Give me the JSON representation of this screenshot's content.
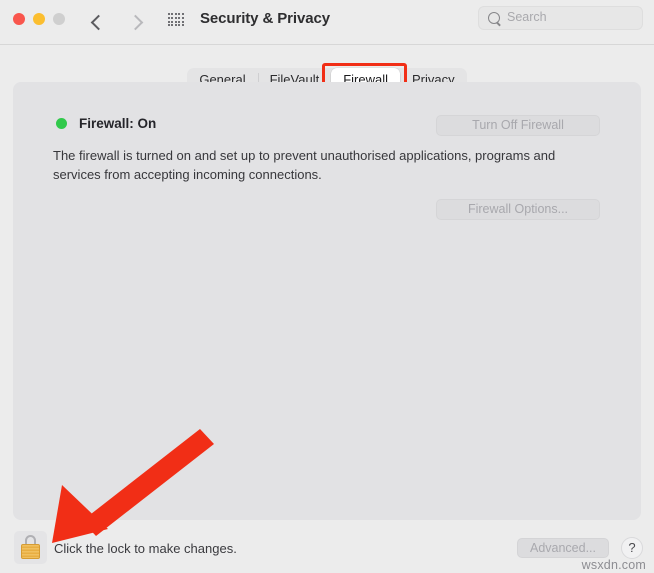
{
  "window": {
    "title": "Security & Privacy",
    "traffic_lights": [
      {
        "name": "close",
        "color": "#f9564d"
      },
      {
        "name": "minimize",
        "color": "#fbbe2f"
      },
      {
        "name": "zoom",
        "color": "#cfcfcf"
      }
    ],
    "nav": {
      "back_icon": "chevron-left-icon",
      "forward_icon": "chevron-right-icon",
      "grid_icon": "grid-view-icon"
    },
    "search": {
      "placeholder": "Search",
      "icon": "search-icon",
      "value": ""
    }
  },
  "tabs": [
    {
      "label": "General",
      "active": false
    },
    {
      "label": "FileVault",
      "active": false
    },
    {
      "label": "Firewall",
      "active": true
    },
    {
      "label": "Privacy",
      "active": false
    }
  ],
  "firewall": {
    "status_label": "Firewall: On",
    "status_color": "#31c94b",
    "status_dot_name": "status-indicator-on",
    "description": "The firewall is turned on and set up to prevent unauthorised applications, programs and services from accepting incoming connections.",
    "turn_off_button": "Turn Off Firewall",
    "options_button": "Firewall Options..."
  },
  "footer": {
    "lock_icon": "padlock-locked-icon",
    "lock_message": "Click the lock to make changes.",
    "advanced_button": "Advanced...",
    "help_button": "?",
    "watermark": "wsxdn.com"
  },
  "annotations": {
    "highlight_color": "#f12e16",
    "rect_target": "Firewall",
    "arrow_target": "padlock-locked-icon"
  }
}
